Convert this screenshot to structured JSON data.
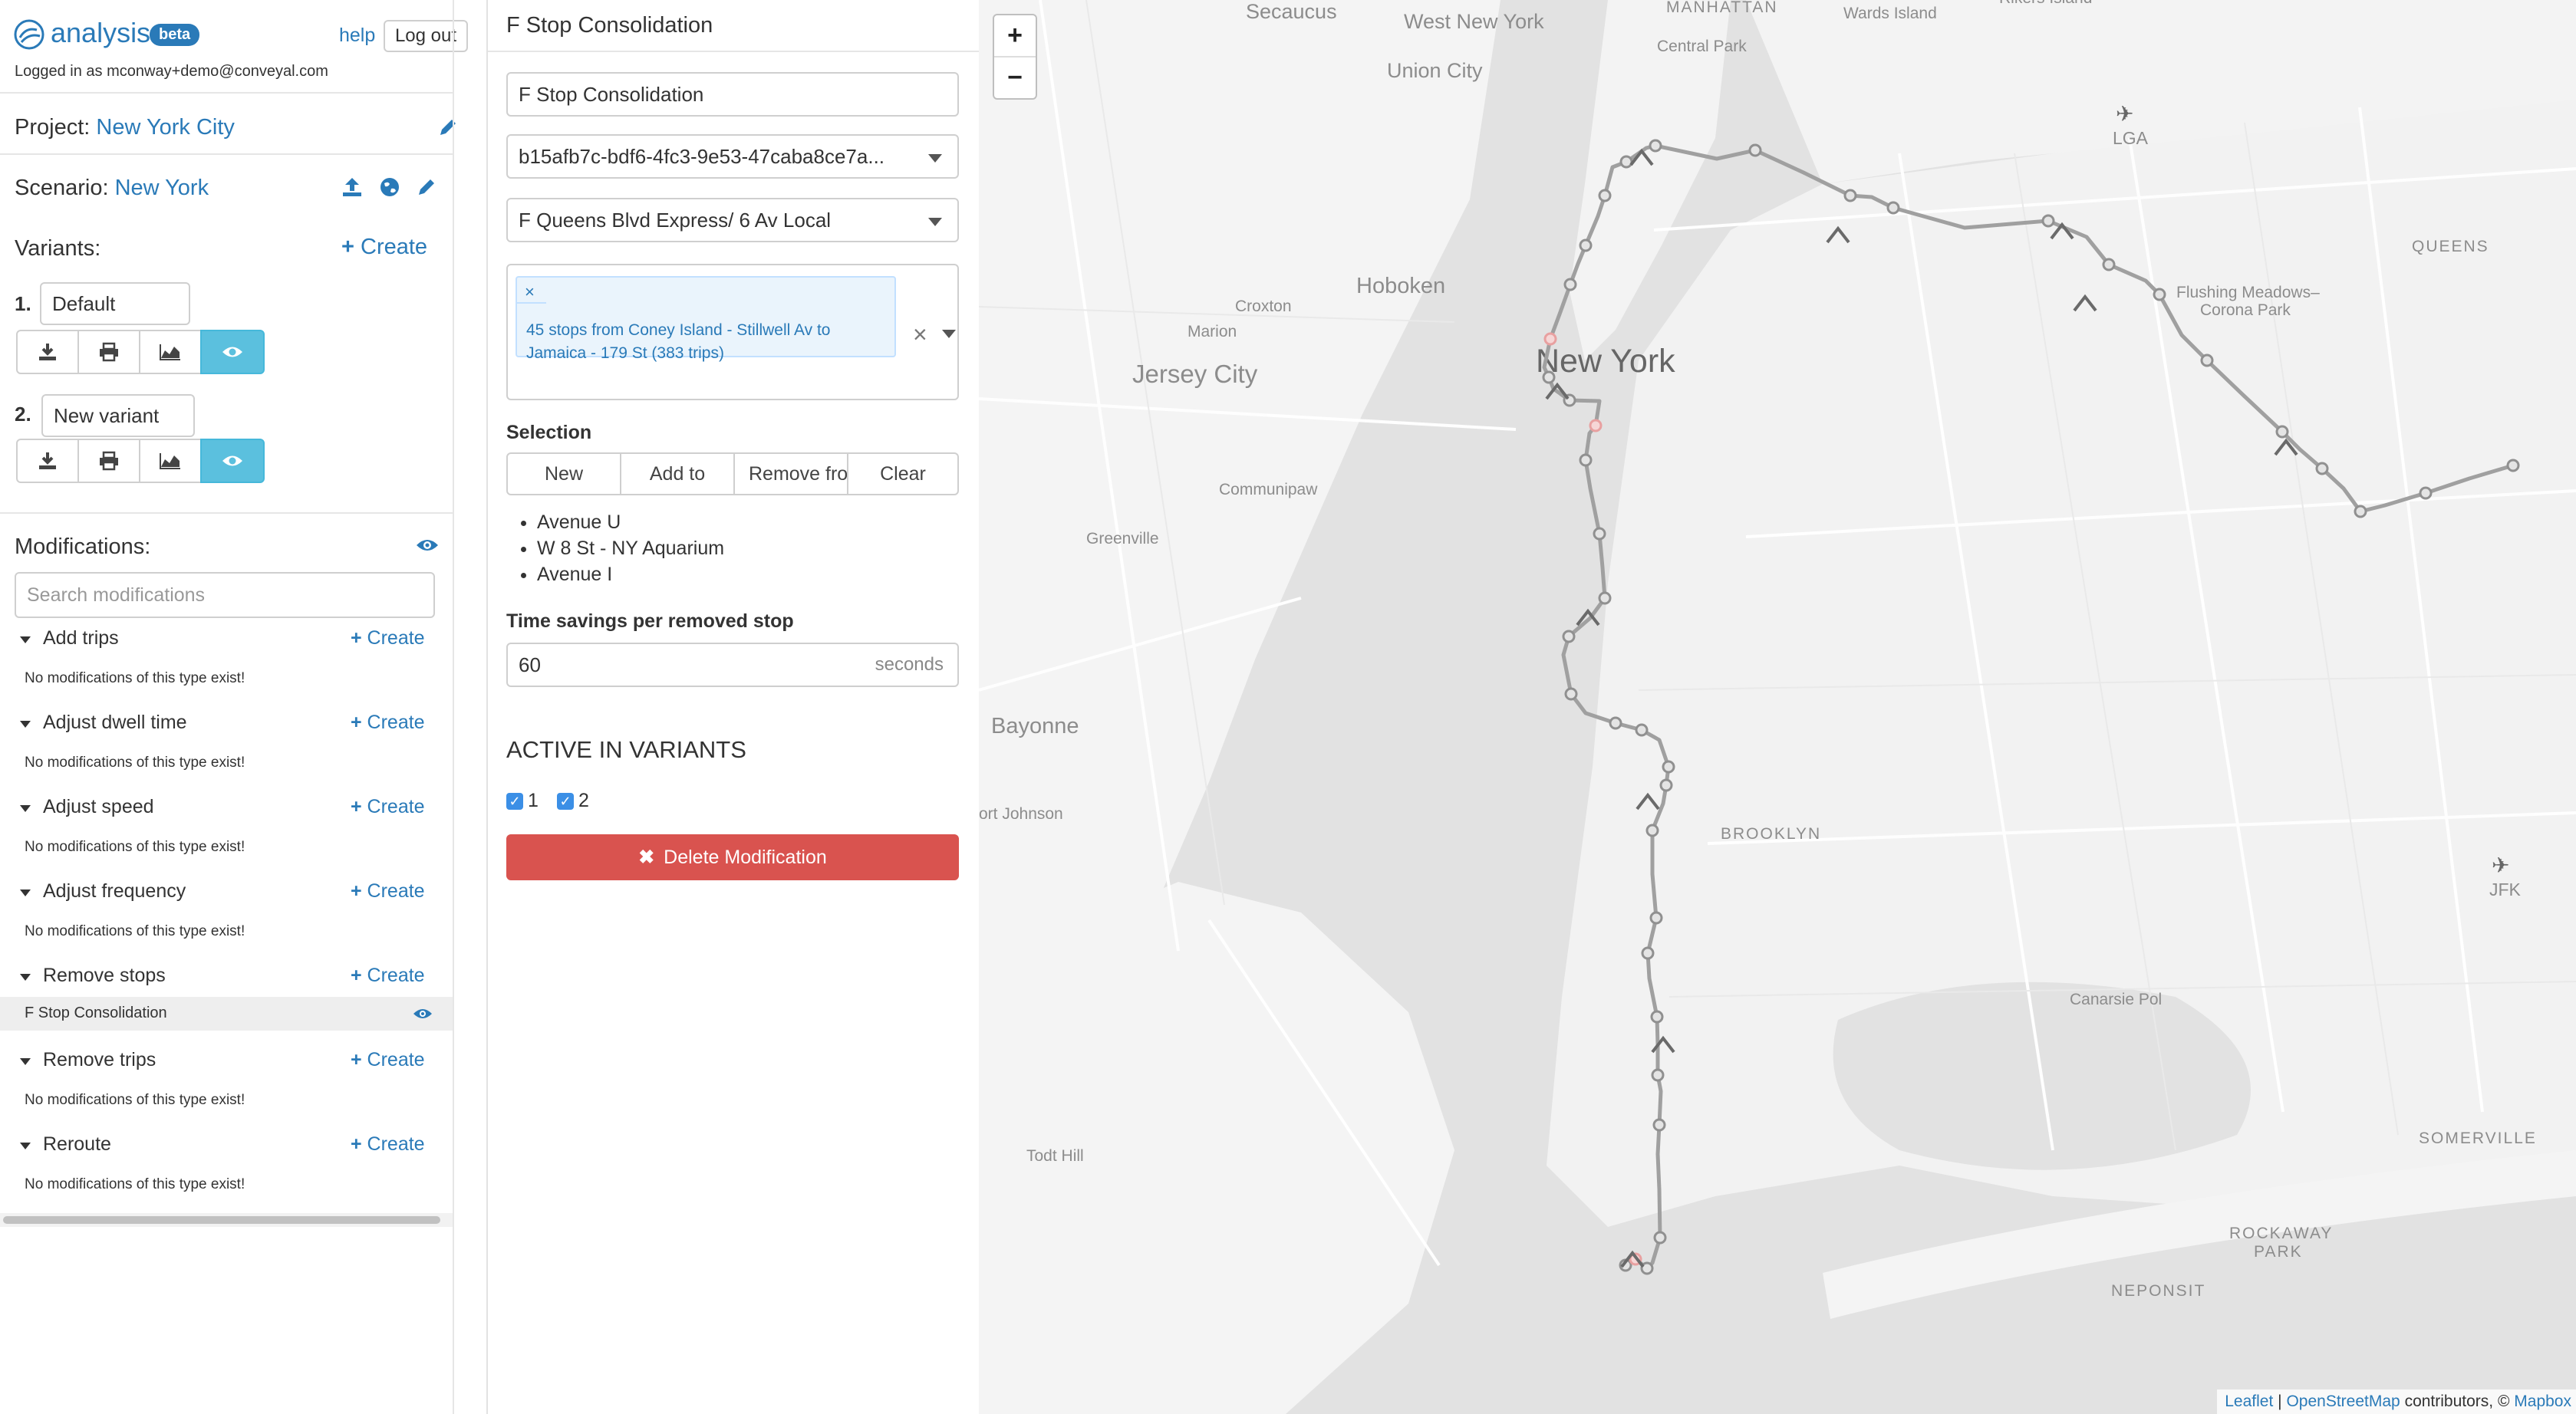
{
  "header": {
    "app_name": "analysis",
    "badge": "beta",
    "help_label": "help",
    "logout_label": "Log out",
    "logged_in_text": "Logged in as mconway+demo@conveyal.com"
  },
  "project": {
    "label": "Project:",
    "name": "New York City"
  },
  "scenario": {
    "label": "Scenario:",
    "name": "New York"
  },
  "variants": {
    "label": "Variants:",
    "create_label": "Create",
    "items": [
      {
        "num": "1.",
        "name": "Default"
      },
      {
        "num": "2.",
        "name": "New variant"
      }
    ]
  },
  "modifications": {
    "label": "Modifications:",
    "search_placeholder": "Search modifications",
    "create_label": "Create",
    "empty_text": "No modifications of this type exist!",
    "groups": [
      {
        "title": "Add trips"
      },
      {
        "title": "Adjust dwell time"
      },
      {
        "title": "Adjust speed"
      },
      {
        "title": "Adjust frequency"
      },
      {
        "title": "Remove stops",
        "items": [
          "F Stop Consolidation"
        ]
      },
      {
        "title": "Remove trips"
      },
      {
        "title": "Reroute"
      }
    ]
  },
  "editor": {
    "title": "F Stop Consolidation",
    "name_value": "F Stop Consolidation",
    "feed_value": "b15afb7c-bdf6-4fc3-9e53-47caba8ce7a...",
    "route_value": "F Queens Blvd Express/ 6 Av Local",
    "pattern_tag_remove": "×",
    "pattern_tag": "45 stops from Coney Island - Stillwell Av to Jamaica - 179 St (383 trips)",
    "pattern_clear": "×",
    "selection_label": "Selection",
    "selection_buttons": [
      "New",
      "Add to",
      "Remove fro",
      "Clear"
    ],
    "selected_stops": [
      "Avenue U",
      "W 8 St - NY Aquarium",
      "Avenue I"
    ],
    "time_savings_label": "Time savings per removed stop",
    "time_savings_value": "60",
    "time_savings_unit": "seconds",
    "active_heading": "ACTIVE IN VARIANTS",
    "variant_checks": [
      {
        "label": "1",
        "checked": true
      },
      {
        "label": "2",
        "checked": true
      }
    ],
    "delete_label": "Delete Modification"
  },
  "map": {
    "zoom_in": "+",
    "zoom_out": "−",
    "attribution": {
      "leaflet": "Leaflet",
      "sep": "|",
      "osm": "OpenStreetMap",
      "contrib": "contributors, ©",
      "mapbox": "Mapbox"
    },
    "route_color": "#a0a0a0",
    "removed_stop_color": "#e8a0a0",
    "labels": {
      "secaucus": "Secaucus",
      "west_new_york": "West New York",
      "manhattan": "MANHATTAN",
      "wards_island": "Wards Island",
      "union_city": "Union City",
      "central_park": "Central Park",
      "lga": "LGA",
      "hoboken": "Hoboken",
      "queens": "QUEENS",
      "croxton": "Croxton",
      "marion": "Marion",
      "flushing_1": "Flushing Meadows–",
      "flushing_2": "Corona Park",
      "jersey_city": "Jersey City",
      "new_york": "New York",
      "communipaw": "Communipaw",
      "greenville": "Greenville",
      "bayonne": "Bayonne",
      "port_johnson": "ort Johnson",
      "brooklyn": "BROOKLYN",
      "jfk": "JFK",
      "canarsie": "Canarsie Pol",
      "todt_hill": "Todt Hill",
      "somerville": "SOMERVILLE",
      "rockaway_1": "ROCKAWAY",
      "rockaway_2": "PARK",
      "neponsit": "NEPONSIT",
      "rikers": "Rikers Island"
    }
  }
}
